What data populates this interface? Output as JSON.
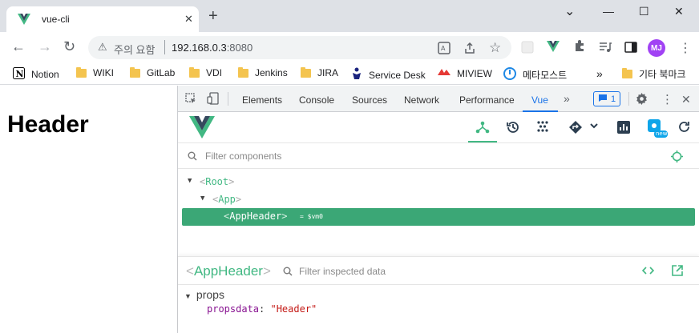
{
  "browser": {
    "tab": {
      "title": "vue-cli"
    },
    "window_controls": {
      "minimize": "—",
      "restore": "☐",
      "close": "✕",
      "dropdown": "⌄"
    },
    "omnibox": {
      "security_label": "주의 요함",
      "host": "192.168.0.3",
      "port": ":8080"
    },
    "profile_initials": "MJ"
  },
  "bookmarks": {
    "items": [
      {
        "label": "Notion",
        "icon": "notion-icon"
      },
      {
        "label": "WIKI",
        "icon": "folder-icon"
      },
      {
        "label": "GitLab",
        "icon": "folder-icon"
      },
      {
        "label": "VDI",
        "icon": "folder-icon"
      },
      {
        "label": "Jenkins",
        "icon": "folder-icon"
      },
      {
        "label": "JIRA",
        "icon": "folder-icon"
      },
      {
        "label": "Service Desk",
        "icon": "servicedesk-icon"
      },
      {
        "label": "MIVIEW",
        "icon": "miview-icon"
      },
      {
        "label": "메타모스트",
        "icon": "mattermost-icon"
      }
    ],
    "overflow": "»",
    "other_label": "기타 북마크"
  },
  "page": {
    "heading": "Header"
  },
  "devtools": {
    "tabs": [
      "Elements",
      "Console",
      "Sources",
      "Network",
      "Performance",
      "Vue"
    ],
    "active_tab": "Vue",
    "more": "»",
    "issues_count": "1",
    "colors": {
      "accent": "#42b883",
      "selected": "#3ba776",
      "devtools_blue": "#1a73e8"
    }
  },
  "vue": {
    "filter_placeholder": "Filter components",
    "new_badge": "new",
    "tree": [
      {
        "open": "<",
        "name": "Root",
        "close": ">",
        "expanded": "▼"
      },
      {
        "open": "<",
        "name": "App",
        "close": ">",
        "expanded": "▼"
      }
    ],
    "selected": {
      "open": "<",
      "name": "AppHeader",
      "close": ">",
      "vm": "= $vm0"
    },
    "inspector": {
      "component": "AppHeader",
      "filter_placeholder": "Filter inspected data",
      "section": "props",
      "prop_key": "propsdata",
      "prop_value": "\"Header\""
    }
  }
}
